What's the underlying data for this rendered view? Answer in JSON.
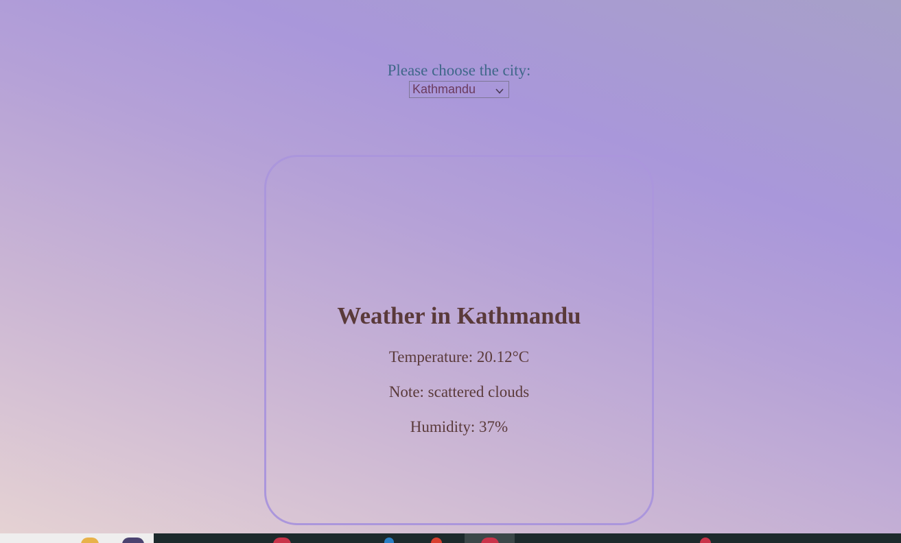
{
  "picker": {
    "label": "Please choose the city:",
    "selected_city": "Kathmandu"
  },
  "weather": {
    "title": "Weather in Kathmandu",
    "temperature": "Temperature: 20.12°C",
    "note": "Note: scattered clouds",
    "humidity": "Humidity: 37%"
  },
  "colors": {
    "label": "#3f6789",
    "card_border": "#ab96dc",
    "card_text": "#5a3a3a",
    "taskbar": "#1d2a2c"
  },
  "icons": {
    "select_arrow": "chevron-down-icon"
  }
}
